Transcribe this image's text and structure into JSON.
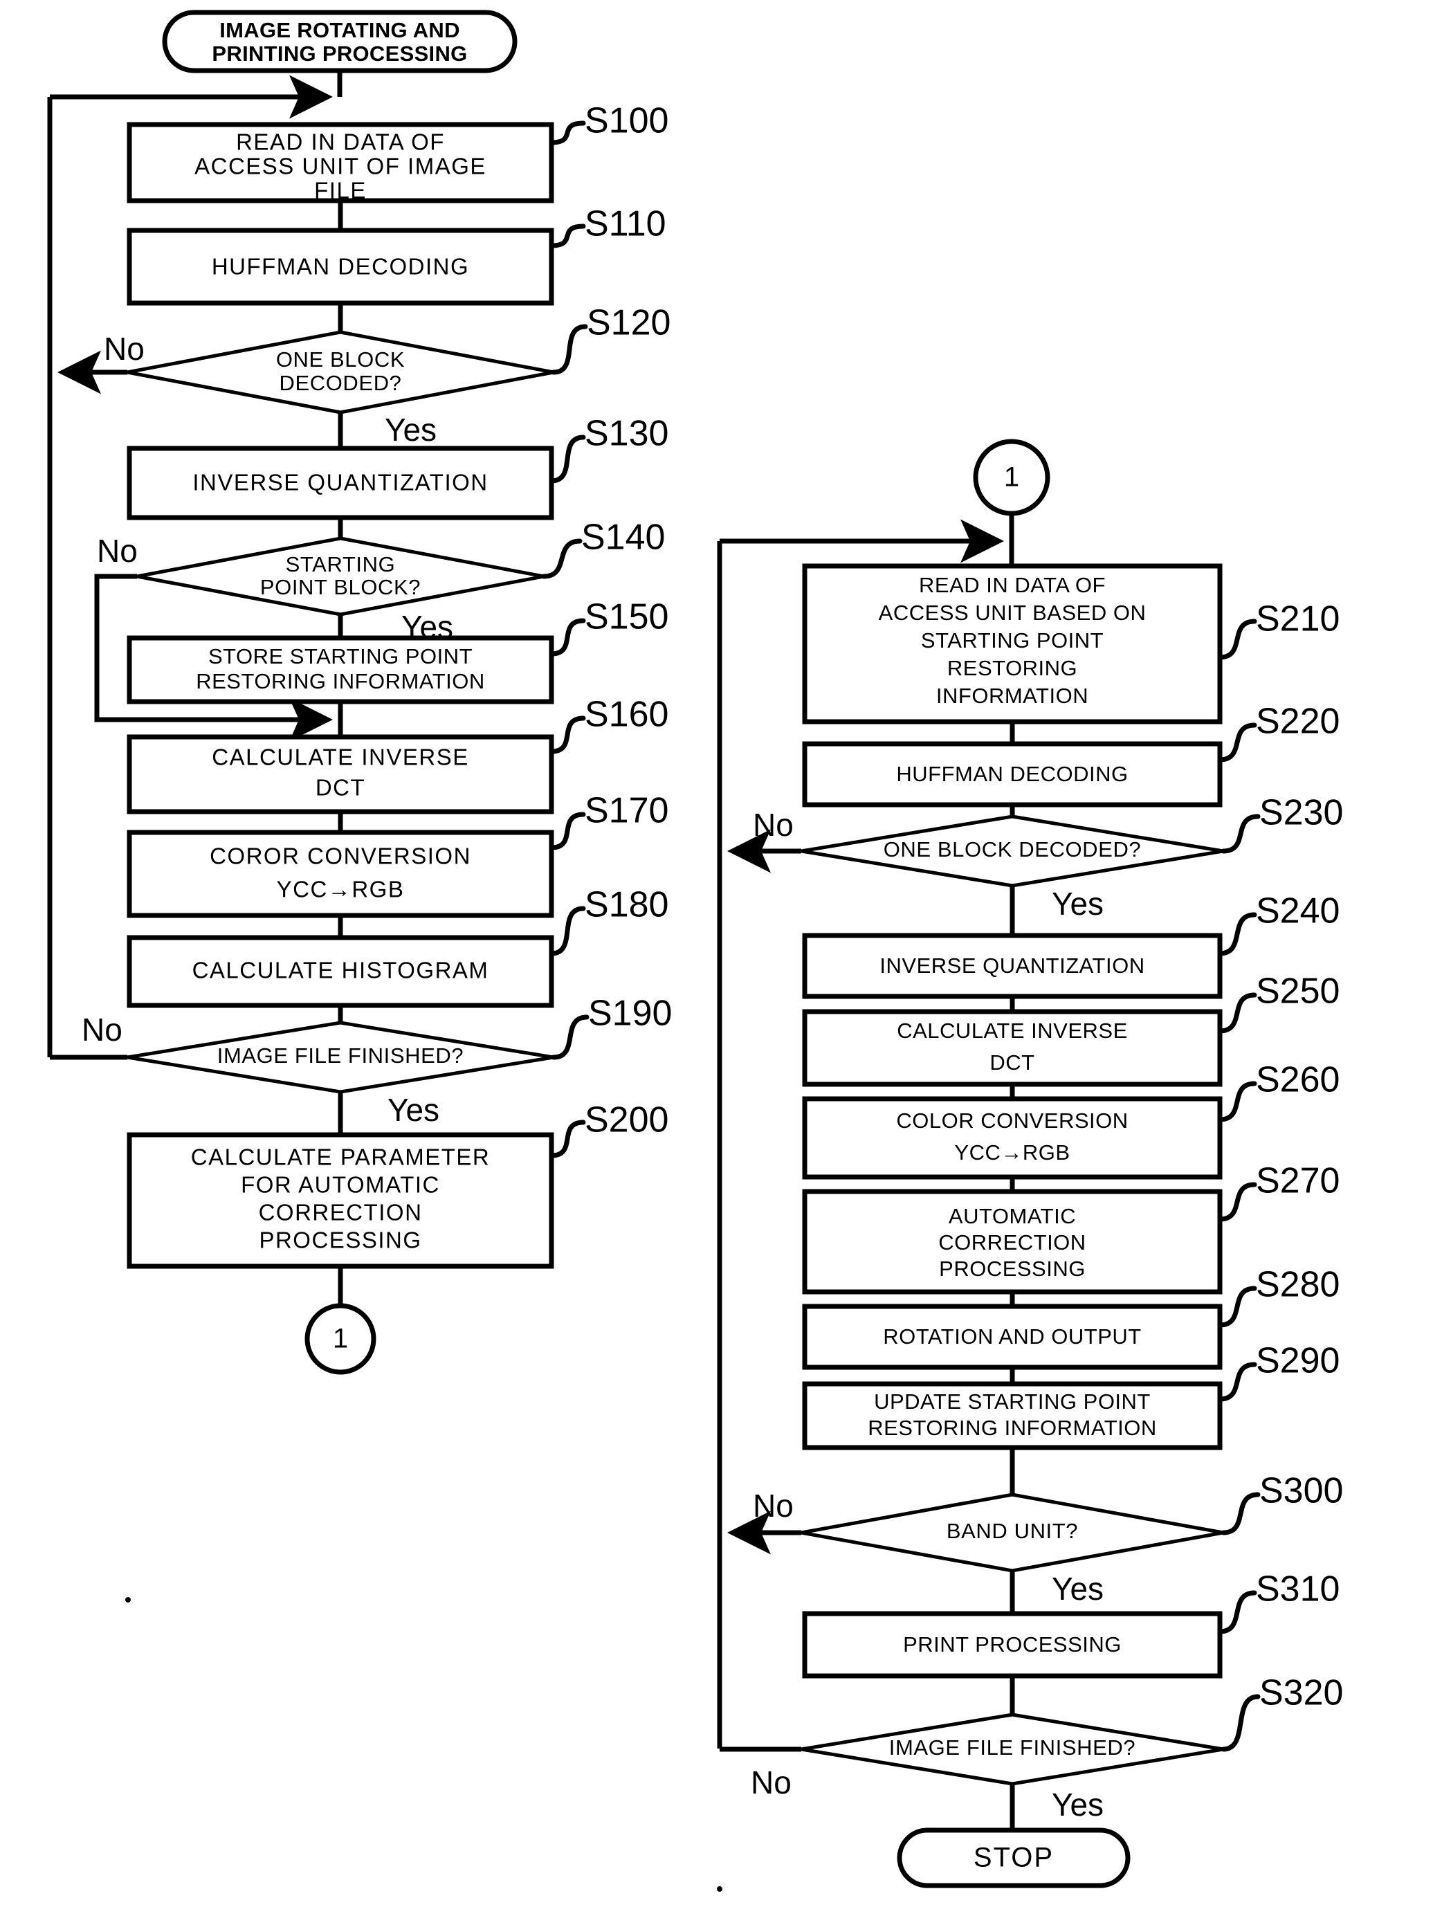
{
  "diagram": {
    "title_terminal": {
      "line1": "IMAGE ROTATING AND",
      "line2": "PRINTING PROCESSING"
    },
    "end_terminal": "STOP",
    "connector_label": "1",
    "labels": {
      "yes": "Yes",
      "no": "No"
    },
    "colors": {
      "ink": "#000000",
      "paper": "#ffffff"
    },
    "left_column": {
      "nodes": [
        {
          "id": "S100",
          "step": "S100",
          "shape": "process",
          "lines": [
            "READ IN DATA OF",
            "ACCESS UNIT OF IMAGE",
            "FILE"
          ]
        },
        {
          "id": "S110",
          "step": "S110",
          "shape": "process",
          "lines": [
            "HUFFMAN DECODING"
          ]
        },
        {
          "id": "S120",
          "step": "S120",
          "shape": "decision",
          "lines": [
            "ONE BLOCK",
            "DECODED?"
          ],
          "yes": "Yes",
          "no": "No"
        },
        {
          "id": "S130",
          "step": "S130",
          "shape": "process",
          "lines": [
            "INVERSE QUANTIZATION"
          ]
        },
        {
          "id": "S140",
          "step": "S140",
          "shape": "decision",
          "lines": [
            "STARTING",
            "POINT BLOCK?"
          ],
          "yes": "Yes",
          "no": "No"
        },
        {
          "id": "S150",
          "step": "S150",
          "shape": "process",
          "lines": [
            "STORE STARTING POINT",
            "RESTORING INFORMATION"
          ]
        },
        {
          "id": "S160",
          "step": "S160",
          "shape": "process",
          "lines": [
            "CALCULATE INVERSE",
            "DCT"
          ]
        },
        {
          "id": "S170",
          "step": "S170",
          "shape": "process",
          "lines": [
            "COROR CONVERSION",
            "YCC→RGB"
          ]
        },
        {
          "id": "S180",
          "step": "S180",
          "shape": "process",
          "lines": [
            "CALCULATE HISTOGRAM"
          ]
        },
        {
          "id": "S190",
          "step": "S190",
          "shape": "decision",
          "lines": [
            "IMAGE FILE FINISHED?"
          ],
          "yes": "Yes",
          "no": "No"
        },
        {
          "id": "S200",
          "step": "S200",
          "shape": "process",
          "lines": [
            "CALCULATE PARAMETER",
            "FOR AUTOMATIC",
            "CORRECTION",
            "PROCESSING"
          ]
        }
      ]
    },
    "right_column": {
      "nodes": [
        {
          "id": "S210",
          "step": "S210",
          "shape": "process",
          "lines": [
            "READ IN DATA OF",
            "ACCESS UNIT BASED ON",
            "STARTING POINT",
            "RESTORING",
            "INFORMATION"
          ]
        },
        {
          "id": "S220",
          "step": "S220",
          "shape": "process",
          "lines": [
            "HUFFMAN DECODING"
          ]
        },
        {
          "id": "S230",
          "step": "S230",
          "shape": "decision",
          "lines": [
            "ONE BLOCK DECODED?"
          ],
          "yes": "Yes",
          "no": "No"
        },
        {
          "id": "S240",
          "step": "S240",
          "shape": "process",
          "lines": [
            "INVERSE QUANTIZATION"
          ]
        },
        {
          "id": "S250",
          "step": "S250",
          "shape": "process",
          "lines": [
            "CALCULATE INVERSE",
            "DCT"
          ]
        },
        {
          "id": "S260",
          "step": "S260",
          "shape": "process",
          "lines": [
            "COLOR CONVERSION",
            "YCC→RGB"
          ]
        },
        {
          "id": "S270",
          "step": "S270",
          "shape": "process",
          "lines": [
            "AUTOMATIC",
            "CORRECTION",
            "PROCESSING"
          ]
        },
        {
          "id": "S280",
          "step": "S280",
          "shape": "process",
          "lines": [
            "ROTATION AND OUTPUT"
          ]
        },
        {
          "id": "S290",
          "step": "S290",
          "shape": "process",
          "lines": [
            "UPDATE STARTING POINT",
            "RESTORING INFORMATION"
          ]
        },
        {
          "id": "S300",
          "step": "S300",
          "shape": "decision",
          "lines": [
            "BAND UNIT?"
          ],
          "yes": "Yes",
          "no": "No"
        },
        {
          "id": "S310",
          "step": "S310",
          "shape": "process",
          "lines": [
            "PRINT PROCESSING"
          ]
        },
        {
          "id": "S320",
          "step": "S320",
          "shape": "decision",
          "lines": [
            "IMAGE FILE FINISHED?"
          ],
          "yes": "Yes",
          "no": "No"
        }
      ]
    }
  }
}
